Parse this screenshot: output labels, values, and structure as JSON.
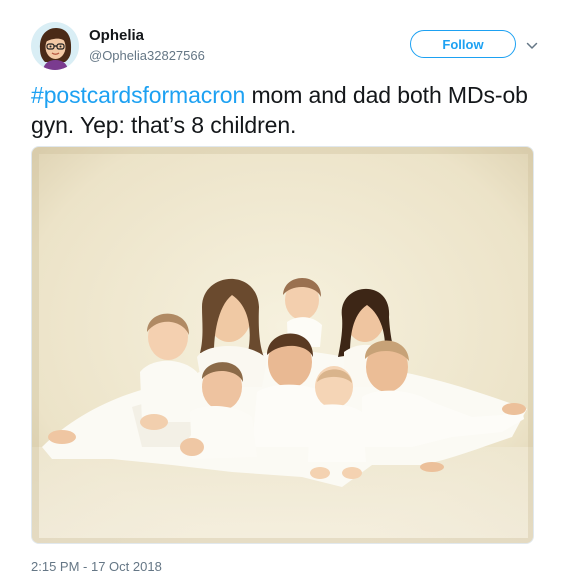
{
  "user": {
    "display_name": "Ophelia",
    "handle": "@Ophelia32827566"
  },
  "follow_button": {
    "label": "Follow"
  },
  "tweet": {
    "hashtag": "#postcardsformacron",
    "text": " mom and dad both MDs-ob gyn. Yep: that’s 8 children.",
    "timestamp": "2:15 PM - 17 Oct 2018"
  },
  "icons": {
    "caret": "chevron-down-icon",
    "avatar": "bitmoji-avatar"
  },
  "colors": {
    "accent": "#1da1f2",
    "text": "#14171a",
    "secondary": "#657786"
  }
}
